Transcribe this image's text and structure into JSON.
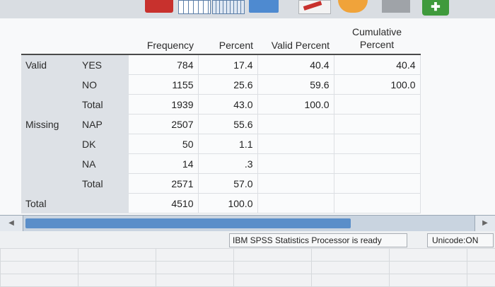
{
  "toolbar": {
    "icons": [
      "bar-chart-icon",
      "data-grid-icon",
      "data-view-icon",
      "split-icon",
      "doc-icon",
      "run-icon",
      "block-icon",
      "add-icon"
    ]
  },
  "table": {
    "headers": {
      "frequency": "Frequency",
      "percent": "Percent",
      "valid_percent": "Valid Percent",
      "cumulative_percent": "Cumulative Percent"
    },
    "groups": {
      "valid": "Valid",
      "missing": "Missing",
      "total": "Total"
    },
    "rows": [
      {
        "group": "Valid",
        "label": "YES",
        "frequency": "784",
        "percent": "17.4",
        "valid_percent": "40.4",
        "cumulative_percent": "40.4"
      },
      {
        "group": "",
        "label": "NO",
        "frequency": "1155",
        "percent": "25.6",
        "valid_percent": "59.6",
        "cumulative_percent": "100.0"
      },
      {
        "group": "",
        "label": "Total",
        "frequency": "1939",
        "percent": "43.0",
        "valid_percent": "100.0",
        "cumulative_percent": ""
      },
      {
        "group": "Missing",
        "label": "NAP",
        "frequency": "2507",
        "percent": "55.6",
        "valid_percent": "",
        "cumulative_percent": ""
      },
      {
        "group": "",
        "label": "DK",
        "frequency": "50",
        "percent": "1.1",
        "valid_percent": "",
        "cumulative_percent": ""
      },
      {
        "group": "",
        "label": "NA",
        "frequency": "14",
        "percent": ".3",
        "valid_percent": "",
        "cumulative_percent": ""
      },
      {
        "group": "",
        "label": "Total",
        "frequency": "2571",
        "percent": "57.0",
        "valid_percent": "",
        "cumulative_percent": ""
      },
      {
        "group": "Total",
        "label": "",
        "frequency": "4510",
        "percent": "100.0",
        "valid_percent": "",
        "cumulative_percent": ""
      }
    ]
  },
  "status": {
    "processor": "IBM SPSS Statistics Processor is ready",
    "unicode": "Unicode:ON"
  }
}
